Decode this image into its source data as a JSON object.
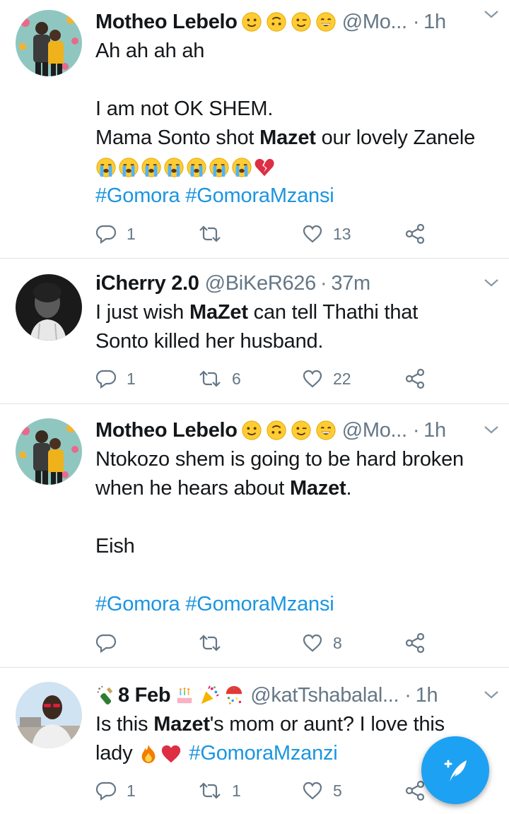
{
  "tweets": [
    {
      "name": "Motheo Lebelo",
      "name_emojis": [
        "slightly-smiling-face",
        "upside-down-face",
        "winking-face",
        "grinning-face"
      ],
      "handle": "@Mo...",
      "dot": "·",
      "time": "1h",
      "lines": [
        "Ah ah ah ah",
        "",
        "I am not OK SHEM."
      ],
      "line4_pre": "Mama Sonto shot ",
      "line4_bold": "Mazet",
      "line4_post": " our lovely Zanele",
      "body_emojis": [
        "loudly-crying-face",
        "loudly-crying-face",
        "loudly-crying-face",
        "loudly-crying-face",
        "loudly-crying-face",
        "loudly-crying-face",
        "loudly-crying-face",
        "broken-heart"
      ],
      "hashtags": "#Gomora #GomoraMzansi",
      "replies": "1",
      "retweets": "",
      "likes": "13"
    },
    {
      "name": "iCherry 2.0",
      "handle": "@BiKeR626",
      "dot": "·",
      "time": "37m",
      "line1_pre": "I just wish ",
      "line1_bold": "MaZet",
      "line1_post": " can tell Thathi that",
      "line2": "Sonto killed her husband.",
      "replies": "1",
      "retweets": "6",
      "likes": "22"
    },
    {
      "name": "Motheo Lebelo",
      "name_emojis": [
        "slightly-smiling-face",
        "upside-down-face",
        "winking-face",
        "grinning-face"
      ],
      "handle": "@Mo...",
      "dot": "·",
      "time": "1h",
      "line1": "Ntokozo shem is going to be hard broken",
      "line2_pre": "when he hears about ",
      "line2_bold": "Mazet",
      "line2_post": ".",
      "line4": "Eish",
      "hashtags": "#Gomora #GomoraMzansi",
      "replies": "",
      "retweets": "",
      "likes": "8"
    },
    {
      "name_prefix_emoji": "bottle-with-popping-cork",
      "name": "8 Feb",
      "name_emojis": [
        "birthday-cake",
        "party-popper",
        "confetti-ball"
      ],
      "handle": "@katTshabalal...",
      "dot": "·",
      "time": "1h",
      "line1_pre": "Is this ",
      "line1_bold": "Mazet",
      "line1_post": "'s mom or aunt? I love this",
      "line2_pre": "lady",
      "line2_emojis": [
        "fire",
        "red-heart"
      ],
      "line2_hashtag": "#GomoraMzanzi",
      "replies": "1",
      "retweets": "1",
      "likes": "5"
    }
  ],
  "icons": {
    "reply": "reply-icon",
    "retweet": "retweet-icon",
    "like": "heart-icon",
    "share": "share-icon",
    "caret": "chevron-down-icon",
    "compose": "compose-tweet-icon"
  },
  "colors": {
    "link": "#1b95e0",
    "secondary": "#657786",
    "fab": "#1da1f2",
    "divider": "#dfe3e7"
  }
}
